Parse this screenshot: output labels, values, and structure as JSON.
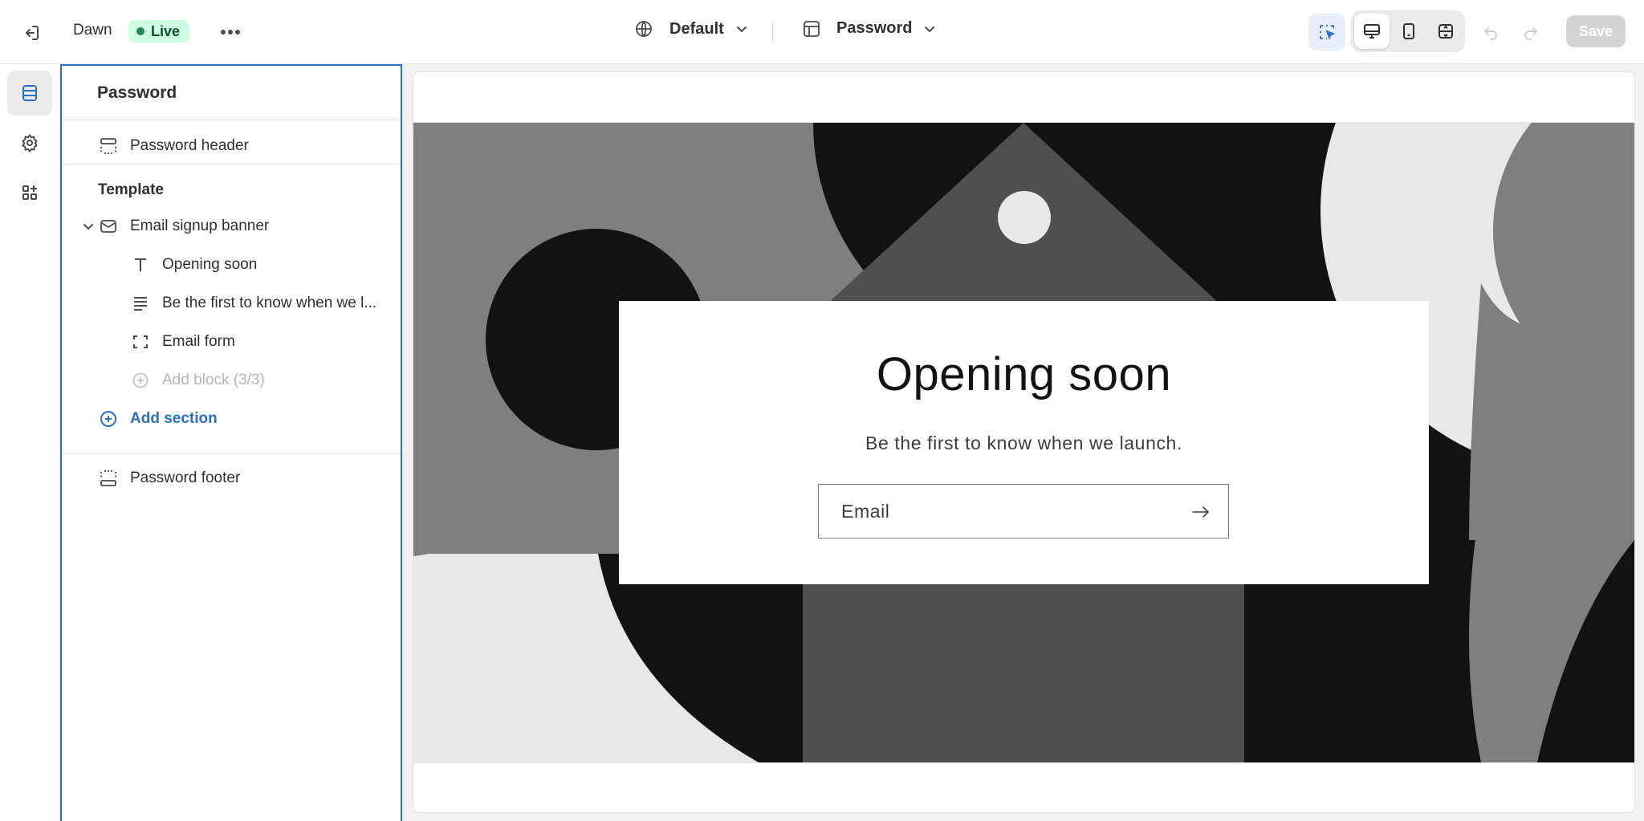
{
  "topbar": {
    "theme_name": "Dawn",
    "status_badge": "Live",
    "language_label": "Default",
    "template_label": "Password",
    "save_label": "Save"
  },
  "sidebar": {
    "title": "Password",
    "header_section": "Password header",
    "template_label": "Template",
    "section": "Email signup banner",
    "blocks": [
      {
        "label": "Opening soon",
        "icon": "text-icon"
      },
      {
        "label": "Be the first to know when we l...",
        "icon": "paragraph-icon"
      },
      {
        "label": "Email form",
        "icon": "email-form-icon"
      }
    ],
    "add_block": "Add block (3/3)",
    "add_section": "Add section",
    "footer_section": "Password footer"
  },
  "preview": {
    "title": "Opening soon",
    "subtitle": "Be the first to know when we launch.",
    "email_placeholder": "Email"
  },
  "colors": {
    "accent": "#2c6ecb",
    "live_bg": "#cdfee1",
    "live_text": "#0c5132",
    "dark": "#121212",
    "mid_gray": "#7f7f7f",
    "light_gray": "#e8e8e8"
  }
}
